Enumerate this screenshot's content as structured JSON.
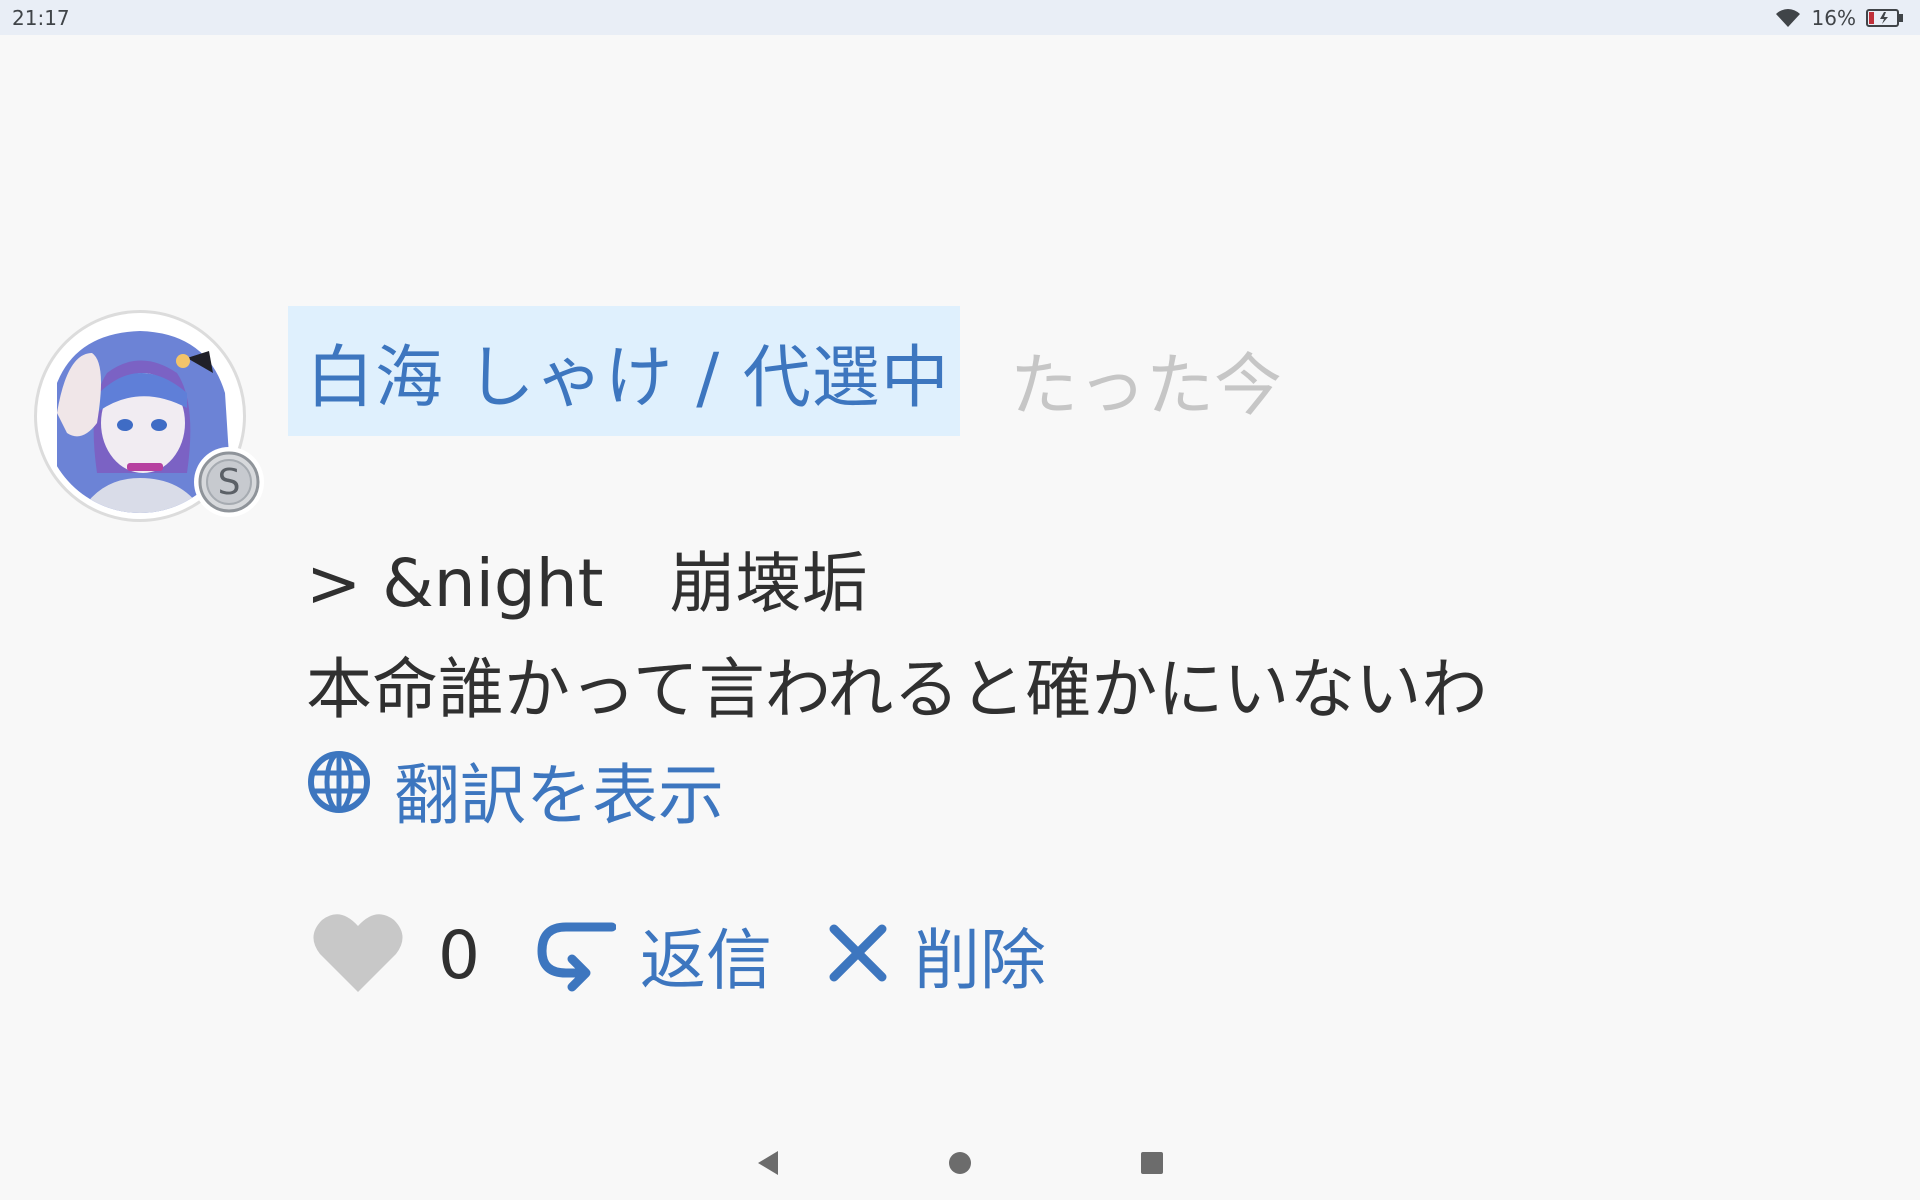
{
  "status_bar": {
    "time": "21:17",
    "battery_percent": "16%",
    "wifi_icon": "wifi-icon",
    "battery_icon": "battery-charging-icon",
    "battery_level": 0.16
  },
  "post": {
    "username": "白海 しゃけ / 代選中",
    "timestamp": "たった今",
    "body_line1": "> &night　崩壊垢",
    "body_line2": "本命誰かって言われると確かにいないわ",
    "translate_label": "翻訳を表示",
    "like_count": "0",
    "reply_label": "返信",
    "delete_label": "削除",
    "badge_letter": "S"
  },
  "colors": {
    "accent": "#3d76bf",
    "username_bg": "#dff0fd",
    "muted": "#c6c6c6",
    "like_heart": "#c8c8c8",
    "text": "#303030",
    "background": "#f8f8f8"
  },
  "icons": {
    "globe": "globe-icon",
    "heart": "heart-icon",
    "reply": "reply-icon",
    "delete": "close-icon",
    "nav_back": "back-triangle-icon",
    "nav_home": "home-circle-icon",
    "nav_recents": "recents-square-icon"
  }
}
